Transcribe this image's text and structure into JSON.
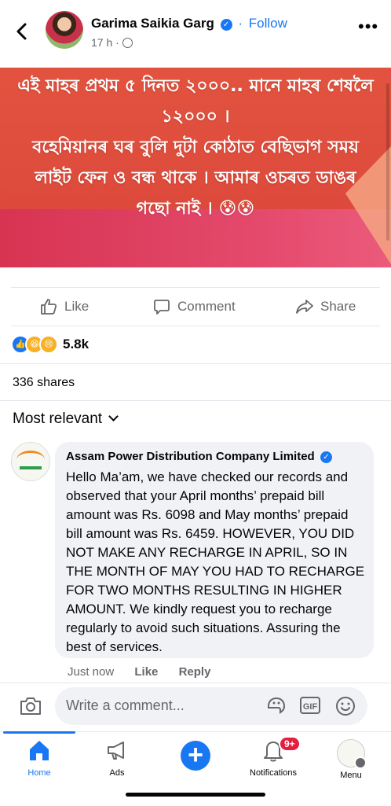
{
  "post": {
    "author": "Garima Saikia Garg",
    "verified_mark": "✓",
    "separator": "·",
    "follow_label": "Follow",
    "time": "17 h ·",
    "banner_text": "এই মাহৰ প্ৰথম ৫ দিনত ২০০০.. মানে মাহৰ শেষলৈ ১২০০০ ।\nবহেমিয়ানৰ ঘৰ বুলি দুটা কোঠাত বেছিভাগ সময় লাইট ফেন ও বন্ধ থাকে । আমাৰ ওচৰত ডাঙৰ গছো নাই । 😰😰"
  },
  "actions": {
    "like": "Like",
    "comment": "Comment",
    "share": "Share"
  },
  "reactions": {
    "count": "5.8k",
    "icons": [
      "like-icon",
      "haha-icon",
      "sad-icon"
    ]
  },
  "shares": "336 shares",
  "sort_label": "Most relevant",
  "comment": {
    "author": "Assam Power Distribution Company Limited",
    "text": "Hello Ma’am, we have checked our records and observed that your April months’ prepaid bill amount was Rs. 6098 and May months’ prepaid bill amount was Rs. 6459. HOWEVER, YOU DID NOT MAKE ANY RECHARGE IN APRIL, SO IN THE MONTH OF MAY YOU HAD TO RECHARGE FOR TWO MONTHS RESULTING IN HIGHER AMOUNT. We kindly request you to recharge regularly to avoid such situations. Assuring the best of services.",
    "time": "Just now",
    "like": "Like",
    "reply": "Reply"
  },
  "composer": {
    "placeholder": "Write a comment...",
    "gif": "GIF"
  },
  "nav": {
    "home": "Home",
    "ads": "Ads",
    "create": "+",
    "notifications": "Notifications",
    "notif_badge": "9+",
    "menu": "Menu"
  },
  "colors": {
    "accent": "#1877f2",
    "banner": "#e2533f",
    "badge": "#e41e3f"
  }
}
